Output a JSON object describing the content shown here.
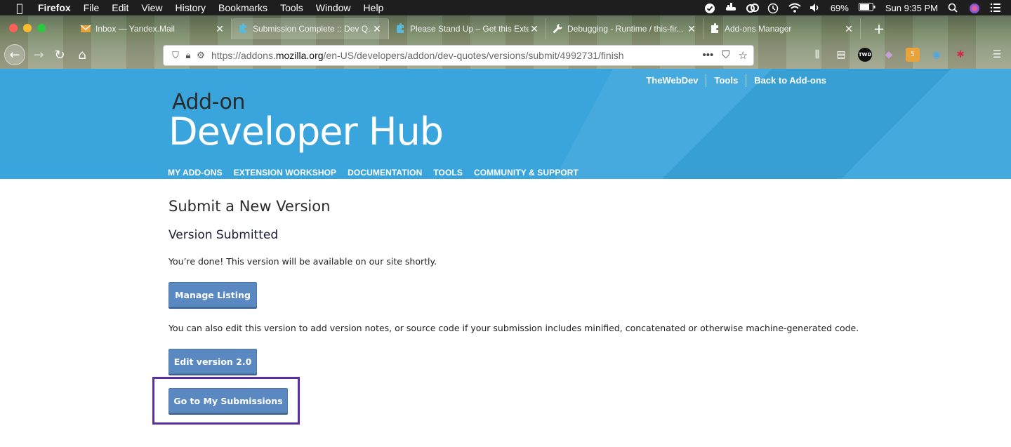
{
  "menubar": {
    "app": "Firefox",
    "items": [
      "File",
      "Edit",
      "View",
      "History",
      "Bookmarks",
      "Tools",
      "Window",
      "Help"
    ],
    "battery": "69%",
    "clock": "Sun 9:35 PM"
  },
  "tabs": [
    {
      "title": "Inbox — Yandex.Mail",
      "favicon": "mail-icon",
      "color": "#e8a33a"
    },
    {
      "title": "Submission Complete :: Dev Q...",
      "favicon": "puzzle-icon",
      "color": "#5bb8d6",
      "active": true
    },
    {
      "title": "Please Stand Up – Get this Exte...",
      "favicon": "puzzle-icon",
      "color": "#5bb8d6"
    },
    {
      "title": "Debugging - Runtime / this-fir...",
      "favicon": "wrench-icon",
      "color": "#ffffff"
    },
    {
      "title": "Add-ons Manager",
      "favicon": "puzzle-icon",
      "color": "#ffffff"
    }
  ],
  "url": {
    "prefix": "https://addons.",
    "host": "mozilla.org",
    "path": "/en-US/developers/addon/dev-quotes/versions/submit/4992731/finish"
  },
  "hub": {
    "top_links": [
      "TheWebDev",
      "Tools",
      "Back to Add-ons"
    ],
    "logo_small": "Add-on",
    "logo_big": "Developer Hub",
    "nav": [
      "MY ADD-ONS",
      "EXTENSION WORKSHOP",
      "DOCUMENTATION",
      "TOOLS",
      "COMMUNITY & SUPPORT"
    ]
  },
  "page": {
    "title": "Submit a New Version",
    "subtitle": "Version Submitted",
    "done_text": "You’re done! This version will be available on our site shortly.",
    "manage_button": "Manage Listing",
    "edit_text": "You can also edit this version to add version notes, or source code if your submission includes minified, concatenated or otherwise machine-generated code.",
    "edit_button": "Edit version 2.0",
    "submissions_button": "Go to My Submissions"
  },
  "colors": {
    "hub_blue": "#3aa5dc",
    "button_blue": "#5a89c1",
    "highlight_purple": "#5b2ea6"
  }
}
